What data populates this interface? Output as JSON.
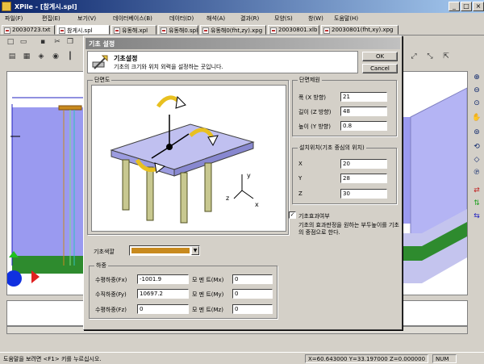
{
  "window": {
    "title": "XPile - [참게시.spl]",
    "min": "_",
    "max": "□",
    "close": "×"
  },
  "menu": [
    "파일(F)",
    "편집(E)",
    "보기(V)",
    "데이터베이스(B)",
    "데이터(D)",
    "해석(A)",
    "결과(R)",
    "모양(S)",
    "창(W)",
    "도움말(H)"
  ],
  "doc_tabs": [
    "20030723.txt",
    "참게시.spl",
    "유동해.xpl",
    "유동해0.spl",
    "유동해0(fht,zy).xpg",
    "20030801.xlb",
    "20030801(fht,xy).xpg"
  ],
  "toolbar_icons": [
    "new-file-icon",
    "open-folder-icon",
    "save-icon",
    "cut-icon",
    "copy-icon",
    "paste-icon"
  ],
  "right_toolbar_icons": [
    "zoom-in-icon",
    "zoom-out-icon",
    "zoom-window-icon",
    "pan-hand-icon",
    "zoom-all-icon",
    "rotate-icon",
    "view-3d-icon",
    "refresh-icon",
    "print-icon",
    "axis-x-icon",
    "axis-y-icon",
    "axis-z-icon"
  ],
  "dialog": {
    "title": "기초 설정",
    "header_title": "기초설정",
    "header_desc": "기초의 크기와 위치 외력을 설정하는 곳입니다.",
    "ok": "OK",
    "cancel": "Cancel",
    "preview_group": "단면도",
    "axis_x": "x",
    "axis_y": "y",
    "axis_z": "z",
    "dim_group": "단면제원",
    "width_label": "폭 (X 방향)",
    "width_value": "21",
    "length_label": "길이 (Z 방향)",
    "length_value": "48",
    "height_label": "높이 (Y 방향)",
    "height_value": "0.8",
    "pos_group": "설치위치(기초 중심의 위치)",
    "x_label": "X",
    "x_value": "20",
    "y_label": "Y",
    "y_value": "28",
    "z_label": "Z",
    "z_value": "30",
    "check_label": "기초효과여부",
    "check_mark": "✓",
    "check_note": "기초의 효과판정을 원하는 부두높이를 기초의 중점으로 한다.",
    "color_label": "기초색깔",
    "color_value": "#c88a1e",
    "load_group": "하중",
    "loads": [
      {
        "label": "수평하중(Fx)",
        "value": "-1001.9",
        "moment_label": "모 멘 트(Mx)",
        "moment_value": "0"
      },
      {
        "label": "수직하중(Fy)",
        "value": "10697.2",
        "moment_label": "모 멘 트(My)",
        "moment_value": "0"
      },
      {
        "label": "수평하중(Fz)",
        "value": "0",
        "moment_label": "모 멘 트(Mz)",
        "moment_value": "0"
      }
    ]
  },
  "status": {
    "text": "도움말을 보려면 <F1> 키를 누르십시오.",
    "coords": "X=60.643000 Y=33.197000 Z=0.000000",
    "num": "NUM"
  },
  "colors": {
    "plane_blue": "#9a9af0",
    "ground_green": "#2e8b2e",
    "pile_cap": "#c88a1e",
    "dialog_face": "#d4d0c8"
  }
}
